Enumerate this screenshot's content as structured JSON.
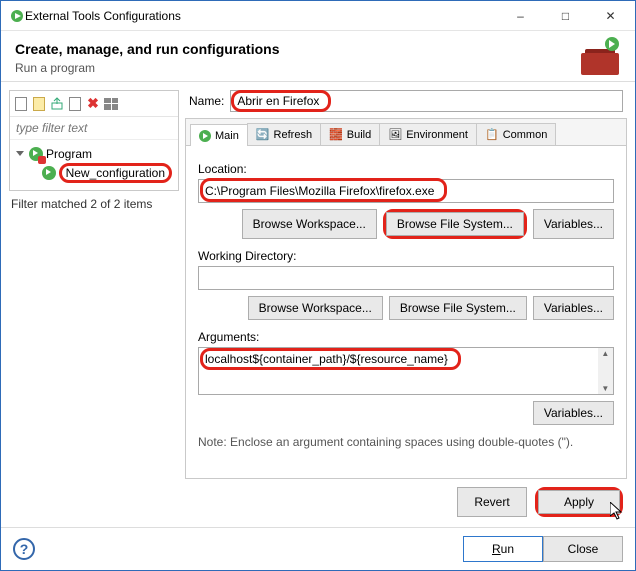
{
  "window": {
    "title": "External Tools Configurations"
  },
  "header": {
    "title": "Create, manage, and run configurations",
    "subtitle": "Run a program"
  },
  "left": {
    "filter_placeholder": "type filter text",
    "tree": {
      "root": "Program",
      "child": "New_configuration"
    },
    "status": "Filter matched 2 of 2 items"
  },
  "form": {
    "name_label": "Name:",
    "name_value": "Abrir en Firefox",
    "tabs": {
      "main": "Main",
      "refresh": "Refresh",
      "build": "Build",
      "environment": "Environment",
      "common": "Common"
    },
    "location": {
      "label": "Location:",
      "value": "C:\\Program Files\\Mozilla Firefox\\firefox.exe",
      "browse_ws": "Browse Workspace...",
      "browse_fs": "Browse File System...",
      "variables": "Variables..."
    },
    "workdir": {
      "label": "Working Directory:",
      "value": "",
      "browse_ws": "Browse Workspace...",
      "browse_fs": "Browse File System...",
      "variables": "Variables..."
    },
    "arguments": {
      "label": "Arguments:",
      "value": "localhost${container_path}/${resource_name}",
      "variables": "Variables...",
      "note": "Note: Enclose an argument containing spaces using double-quotes (\")."
    },
    "revert": "Revert",
    "apply": "Apply"
  },
  "footer": {
    "run": "Run",
    "close": "Close"
  }
}
